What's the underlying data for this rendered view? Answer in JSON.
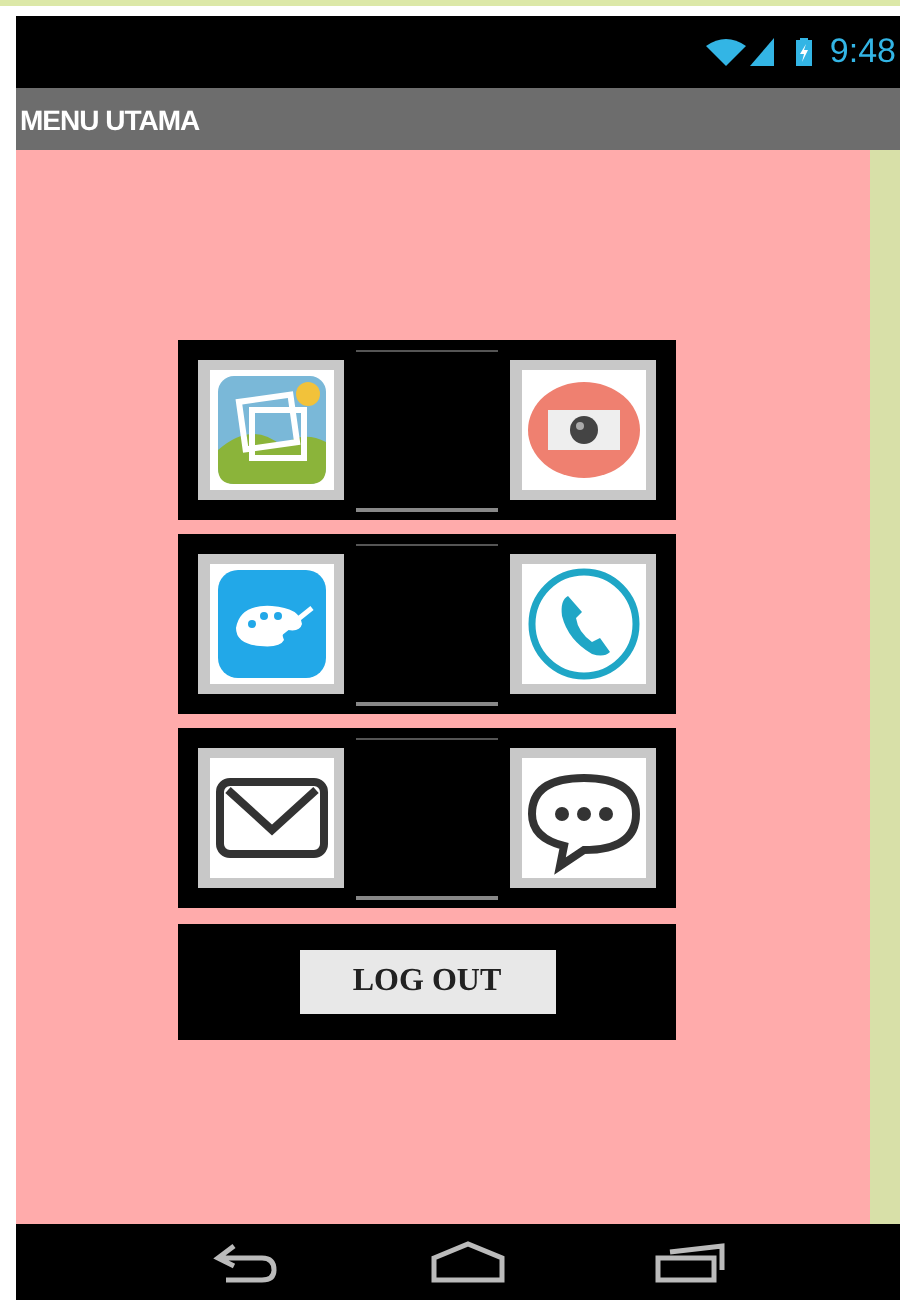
{
  "status_bar": {
    "time": "9:48"
  },
  "title_bar": {
    "title": "MENU UTAMA"
  },
  "logout_button": {
    "label": "LOG OUT"
  }
}
